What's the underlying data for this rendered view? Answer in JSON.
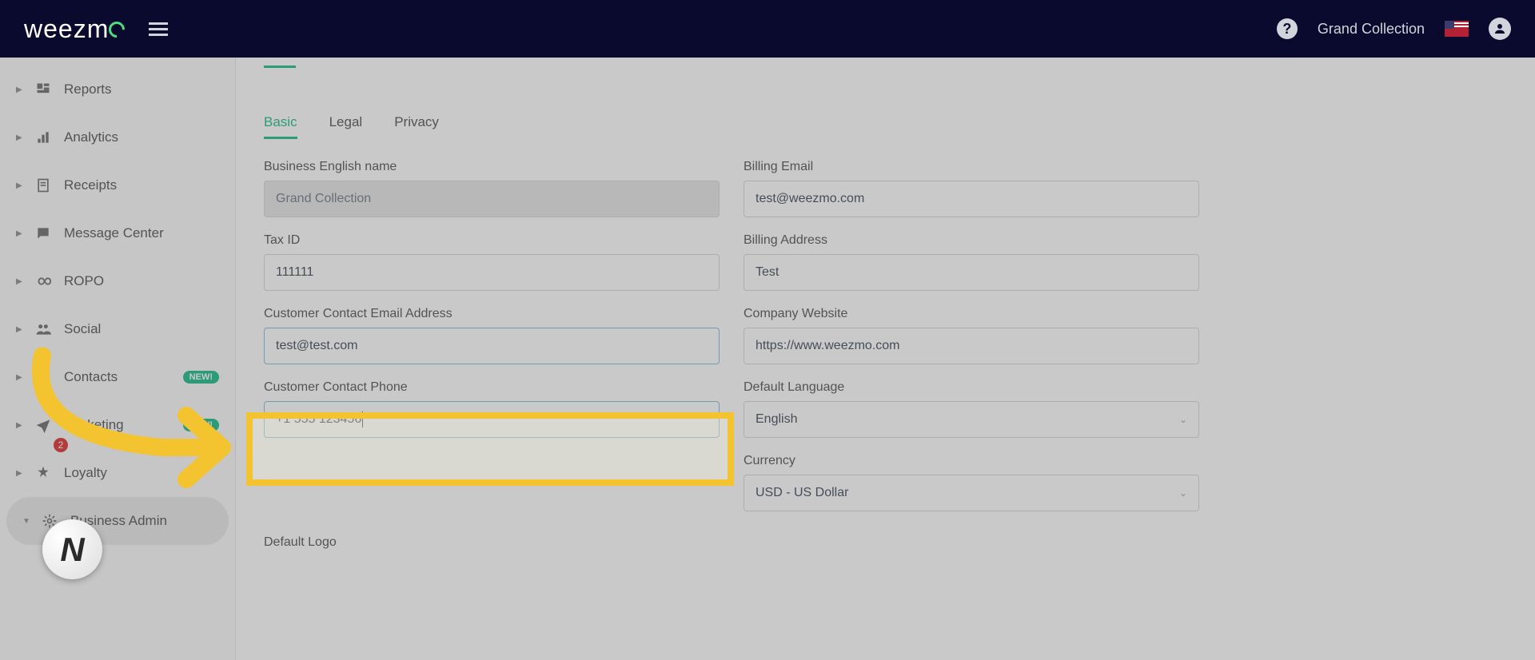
{
  "header": {
    "logo_text": "weezm",
    "org_name": "Grand Collection"
  },
  "sidebar": {
    "items": [
      {
        "label": "Reports",
        "icon": "dashboard"
      },
      {
        "label": "Analytics",
        "icon": "chart"
      },
      {
        "label": "Receipts",
        "icon": "receipt"
      },
      {
        "label": "Message Center",
        "icon": "message"
      },
      {
        "label": "ROPO",
        "icon": "infinity"
      },
      {
        "label": "Social",
        "icon": "people"
      },
      {
        "label": "Contacts",
        "icon": "contact",
        "badge": "NEW!"
      },
      {
        "label": "Marketing",
        "icon": "send",
        "badge": "NEW!"
      },
      {
        "label": "Loyalty",
        "icon": "loyalty",
        "notif": "2"
      },
      {
        "label": "Business Admin",
        "icon": "gear",
        "active": true
      }
    ]
  },
  "subtabs": [
    {
      "label": "Basic",
      "active": true
    },
    {
      "label": "Legal"
    },
    {
      "label": "Privacy"
    }
  ],
  "form": {
    "business_name_label": "Business English name",
    "business_name_value": "Grand Collection",
    "billing_email_label": "Billing Email",
    "billing_email_value": "test@weezmo.com",
    "tax_id_label": "Tax ID",
    "tax_id_value": "111111",
    "billing_address_label": "Billing Address",
    "billing_address_value": "Test",
    "contact_email_label": "Customer Contact Email Address",
    "contact_email_value": "test@test.com",
    "company_website_label": "Company Website",
    "company_website_value": "https://www.weezmo.com",
    "contact_phone_label": "Customer Contact Phone",
    "contact_phone_value": "+1 555 123456",
    "default_language_label": "Default Language",
    "default_language_value": "English",
    "currency_label": "Currency",
    "currency_value": "USD - US Dollar",
    "default_logo_label": "Default Logo"
  }
}
